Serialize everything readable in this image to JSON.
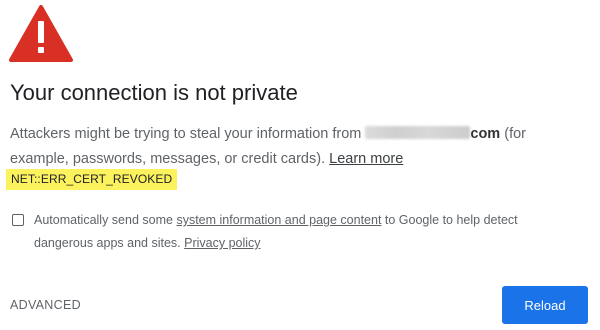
{
  "icon": {
    "name": "warning-triangle-icon",
    "color": "#d93025",
    "glyph": "!"
  },
  "title": "Your connection is not private",
  "message": {
    "part1": "Attackers might be trying to steal your information from",
    "domain_suffix": "com",
    "part2": "(for example, passwords, messages, or credit cards).",
    "learn_more": "Learn more"
  },
  "error_code": "NET::ERR_CERT_REVOKED",
  "error_code_highlight": "#fbf25e",
  "optin": {
    "checked": false,
    "text_before": "Automatically send some",
    "link": "system information and page content",
    "text_after": "to Google to help detect dangerous apps and sites.",
    "privacy_link": "Privacy policy"
  },
  "footer": {
    "advanced_label": "ADVANCED",
    "reload_label": "Reload",
    "reload_color": "#1a73e8"
  }
}
